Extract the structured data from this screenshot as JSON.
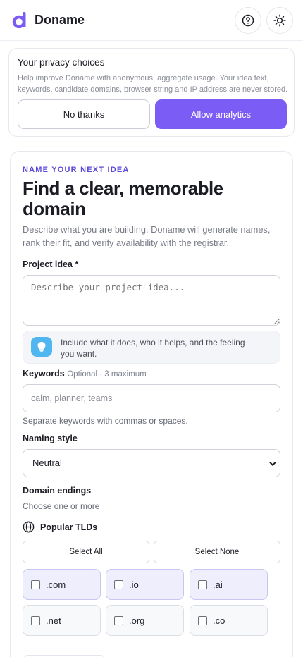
{
  "header": {
    "brand_name": "Doname",
    "brand_color": "#7b5cf5",
    "help_icon": "help-icon",
    "theme_icon": "sun-icon"
  },
  "privacy": {
    "title": "Your privacy choices",
    "text": "Help improve Doname with anonymous, aggregate usage. Your idea text, keywords, candidate domains, browser string and IP address are never stored.",
    "decline_label": "No thanks",
    "allow_label": "Allow analytics"
  },
  "form": {
    "eyebrow": "NAME YOUR NEXT IDEA",
    "headline": "Find a clear, memorable domain",
    "intro": "Describe what you are building. Doname will generate names, rank their fit, and verify availability with the registrar.",
    "idea_label": "Project idea *",
    "idea_placeholder": "Describe your project idea...",
    "tip_text": "Include what it does, who it helps, and the feeling you want.",
    "keywords_label": "Keywords",
    "keywords_optional": "Optional · 3 maximum",
    "keywords_placeholder": "calm, planner, teams",
    "keywords_hint": "Separate keywords with commas or spaces.",
    "style_label": "Naming style",
    "style_value": "Neutral",
    "endings_label": "Domain endings",
    "endings_hint": "Choose one or more",
    "tld_group_label": "Popular TLDs",
    "select_all": "Select All",
    "select_none": "Select None",
    "tlds": [
      {
        "label": ".com",
        "selected": true
      },
      {
        "label": ".io",
        "selected": true
      },
      {
        "label": ".ai",
        "selected": true
      },
      {
        "label": ".net",
        "selected": false
      },
      {
        "label": ".org",
        "selected": false
      },
      {
        "label": ".co",
        "selected": false
      }
    ]
  }
}
